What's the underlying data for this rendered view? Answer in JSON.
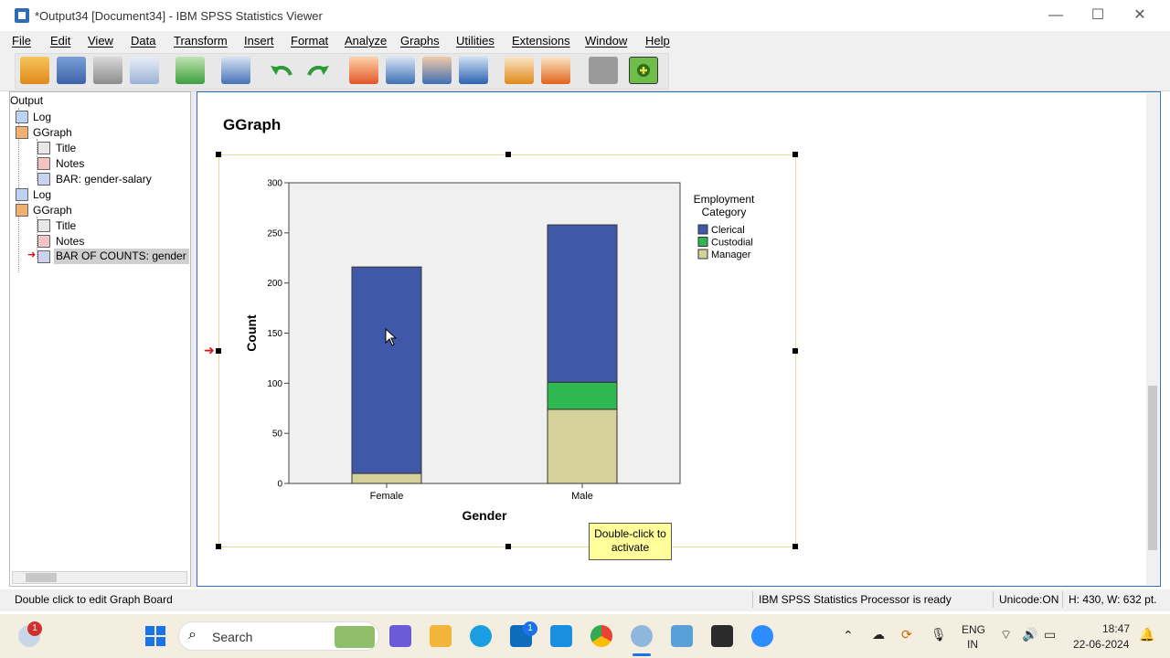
{
  "window": {
    "title": "*Output34 [Document34] - IBM SPSS Statistics Viewer",
    "minimize": "—",
    "maximize": "☐",
    "close": "✕"
  },
  "menu": {
    "items": [
      "File",
      "Edit",
      "View",
      "Data",
      "Transform",
      "Insert",
      "Format",
      "Analyze",
      "Graphs",
      "Utilities",
      "Extensions",
      "Window",
      "Help"
    ]
  },
  "toolbar": {
    "buttons": [
      "open-folder",
      "save",
      "print",
      "print-preview",
      "export",
      "recall-dialog",
      "undo",
      "redo",
      "goto-data",
      "goto-variable",
      "insert-cases",
      "insert-variable",
      "designate-window",
      "show-all-output",
      "hide",
      "add-output"
    ]
  },
  "outline": {
    "root": "Output",
    "items": [
      {
        "label": "Log"
      },
      {
        "label": "GGraph"
      },
      {
        "label": "Title"
      },
      {
        "label": "Notes"
      },
      {
        "label": "BAR: gender-salary"
      },
      {
        "label": "Log"
      },
      {
        "label": "GGraph"
      },
      {
        "label": "Title"
      },
      {
        "label": "Notes"
      },
      {
        "label": "BAR OF COUNTS: gender"
      }
    ]
  },
  "content": {
    "heading": "GGraph",
    "tooltip_line1": "Double-click to",
    "tooltip_line2": "activate"
  },
  "chart_data": {
    "type": "bar",
    "stacked": true,
    "categories": [
      "Female",
      "Male"
    ],
    "series": [
      {
        "name": "Manager",
        "color": "#d4d19a",
        "values": [
          10,
          74
        ]
      },
      {
        "name": "Custodial",
        "color": "#2fb84f",
        "values": [
          0,
          27
        ]
      },
      {
        "name": "Clerical",
        "color": "#3f59a8",
        "values": [
          206,
          157
        ]
      }
    ],
    "xlabel": "Gender",
    "ylabel": "Count",
    "ylim": [
      0,
      300
    ],
    "yticks": [
      0,
      50,
      100,
      150,
      200,
      250,
      300
    ],
    "legend_title": "Employment Category",
    "legend_entries": [
      "Clerical",
      "Custodial",
      "Manager"
    ],
    "legend_placement": "right",
    "grid": false
  },
  "statusbar": {
    "hint": "Double click to edit Graph Board",
    "processor": "IBM SPSS Statistics Processor is ready",
    "unicode": "Unicode:ON",
    "dims": "H: 430, W: 632 pt."
  },
  "taskbar": {
    "search_placeholder": "Search",
    "weather_badge": "1",
    "teams_badge": "1",
    "lang_top": "ENG",
    "lang_bottom": "IN",
    "time": "18:47",
    "date": "22-06-2024"
  }
}
